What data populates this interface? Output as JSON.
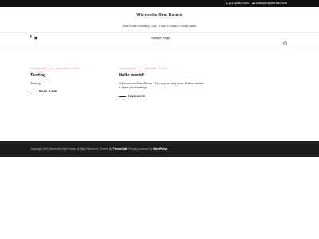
{
  "topbar": {
    "phone": "(123)456-7890",
    "email": "example@domain.com"
  },
  "header": {
    "site_title": "Winnertia Real Estate",
    "tagline": "Real Estate Investing Club – Time to Invest in Real Estate!"
  },
  "nav": {
    "socials": [
      {
        "icon": "facebook-icon",
        "glyph": "f"
      },
      {
        "icon": "twitter-icon",
        "glyph": "t"
      }
    ],
    "menu": [
      "Sample Page"
    ],
    "search_icon": "search-icon"
  },
  "posts": [
    {
      "category": "Uncategorized",
      "date": "September 14, 2020",
      "title": "Testing",
      "excerpt": "Testing",
      "read_more": "READ MORE"
    },
    {
      "category": "Uncategorized",
      "date": "September 14, 2020",
      "title": "Hello world!",
      "excerpt": "Welcome to WordPress. This is your first post. Edit or delete it, then start writing!",
      "read_more": "READ MORE"
    }
  ],
  "footer": {
    "copyright": "Copyright 2020 Winnertia Real Estate All Right Reserved. Theme By",
    "theme_author": "ThemeCatt",
    "powered_text": "Proudly powered by",
    "powered_link": "WordPress"
  },
  "colors": {
    "topbar_bg": "#111111",
    "accent": "#e48a8a",
    "footer_bg": "#1c1c1c"
  }
}
